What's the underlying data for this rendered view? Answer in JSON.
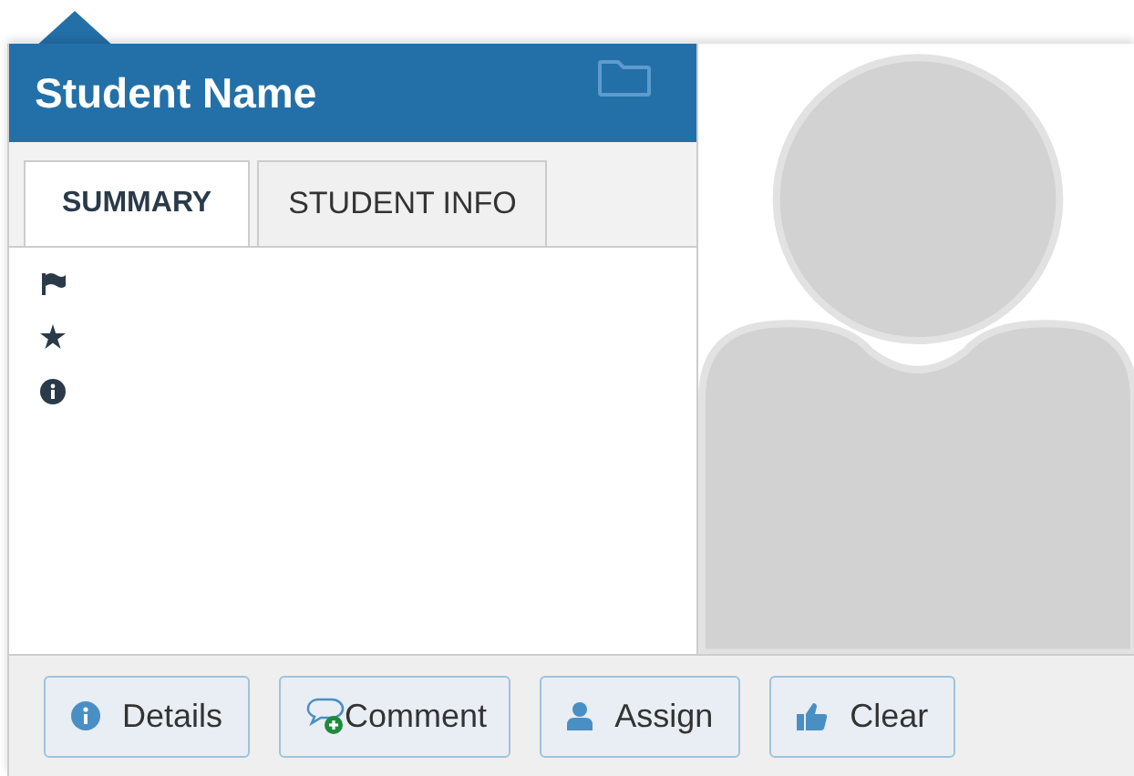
{
  "header": {
    "title": "Student Name"
  },
  "tabs": [
    {
      "label": "SUMMARY",
      "selected": true
    },
    {
      "label": "STUDENT INFO",
      "selected": false
    }
  ],
  "buttons": [
    {
      "label": "Details"
    },
    {
      "label": "Comment"
    },
    {
      "label": "Assign"
    },
    {
      "label": "Clear"
    }
  ]
}
